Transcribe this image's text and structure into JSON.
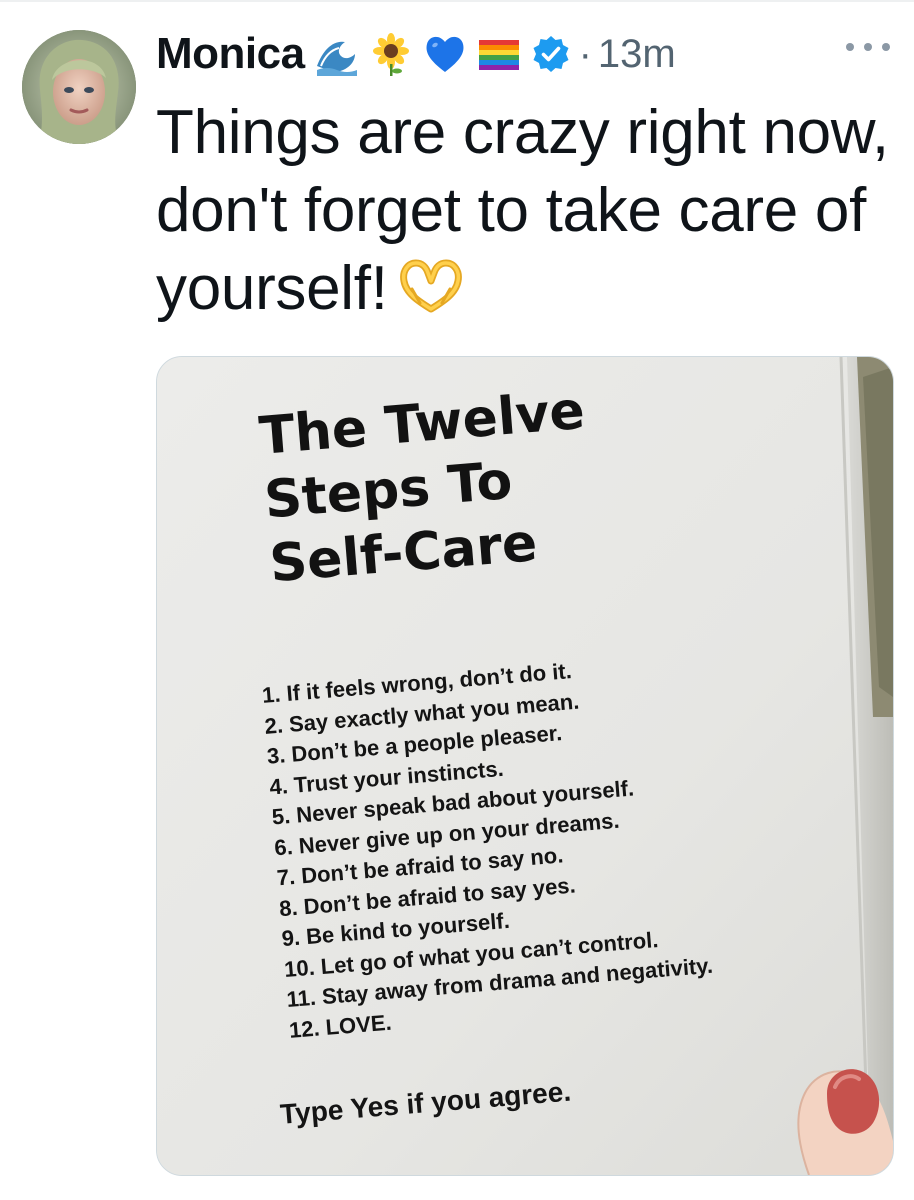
{
  "tweet": {
    "author_name": "Monica",
    "name_emojis": [
      "wave-emoji",
      "sunflower-emoji",
      "blue-heart-emoji",
      "rainbow-flag-emoji"
    ],
    "verified": true,
    "separator": "·",
    "timestamp": "13m",
    "text": "Things are crazy right now, don't forget to take care of yourself!",
    "text_emoji": "heart-hands-emoji",
    "accent_color": "#1d9bf0"
  },
  "media": {
    "title_lines": [
      "The Twelve",
      "Steps To",
      "Self-Care"
    ],
    "steps": [
      "1. If it feels wrong, don’t do it.",
      "2. Say exactly what you mean.",
      "3. Don’t be a people pleaser.",
      "4. Trust your instincts.",
      "5. Never speak bad about yourself.",
      "6. Never give up on your dreams.",
      "7. Don’t be afraid to say no.",
      "8. Don’t be afraid to say yes.",
      "9. Be kind to yourself.",
      "10. Let go of what you can’t control.",
      "11. Stay away from drama and negativity.",
      "12. LOVE."
    ],
    "call_to_action": "Type Yes if you agree."
  }
}
